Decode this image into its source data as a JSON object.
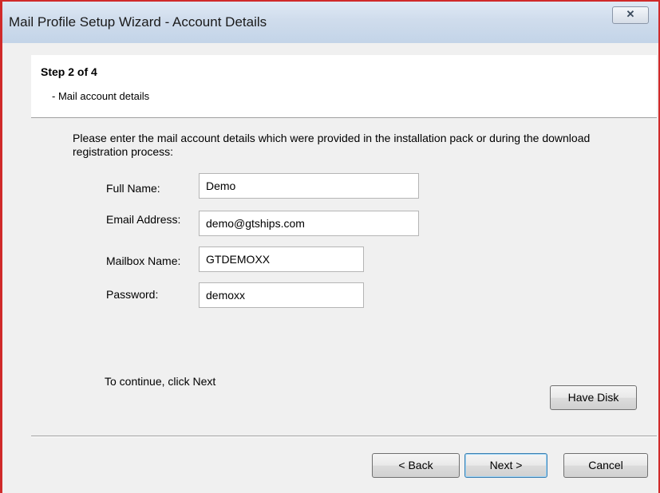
{
  "window": {
    "title": "Mail Profile Setup Wizard - Account Details",
    "close_glyph": "✕"
  },
  "header": {
    "step": "Step 2 of 4",
    "subtitle": "- Mail account details"
  },
  "instructions": "Please enter the mail account details which were provided in the installation pack or during the download registration process:",
  "form": {
    "full_name": {
      "label": "Full Name:",
      "value": "Demo"
    },
    "email": {
      "label": "Email Address:",
      "value": "demo@gtships.com"
    },
    "mailbox": {
      "label": "Mailbox Name:",
      "value": "GTDEMOXX"
    },
    "password": {
      "label": "Password:",
      "value": "demoxx"
    }
  },
  "continue_text": "To continue, click Next",
  "buttons": {
    "have_disk": "Have Disk",
    "back": "< Back",
    "next": "Next >",
    "cancel": "Cancel"
  }
}
